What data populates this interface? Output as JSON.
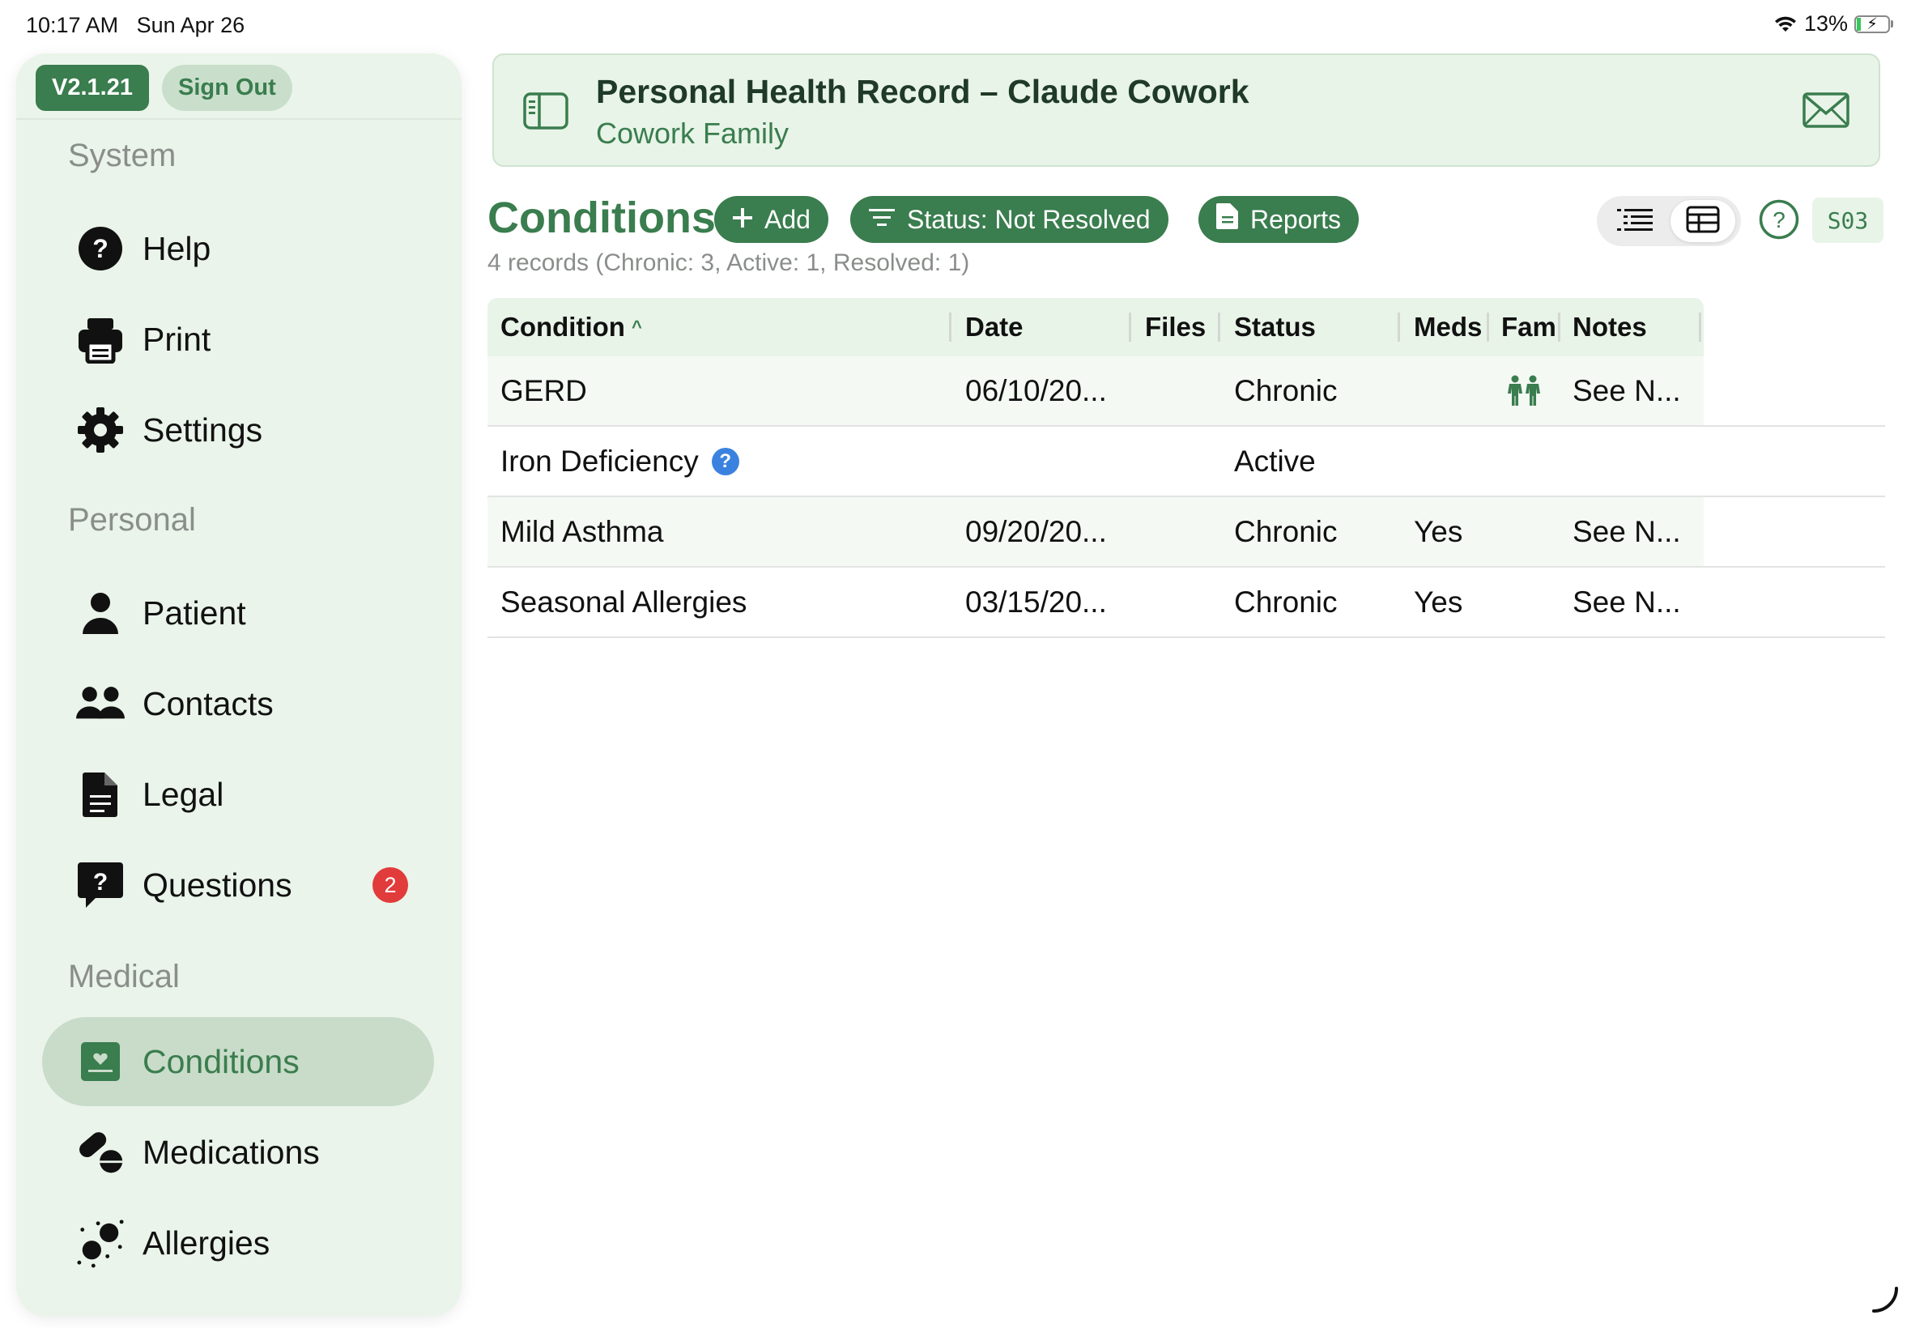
{
  "status_bar": {
    "time": "10:17 AM",
    "date": "Sun Apr 26",
    "battery": "13%",
    "battery_level": 0.13
  },
  "sidebar": {
    "version": "V2.1.21",
    "sign_out": "Sign Out",
    "sections": {
      "system": "System",
      "personal": "Personal",
      "medical": "Medical"
    },
    "items": {
      "help": "Help",
      "print": "Print",
      "settings": "Settings",
      "patient": "Patient",
      "contacts": "Contacts",
      "legal": "Legal",
      "questions": "Questions",
      "questions_badge": "2",
      "conditions": "Conditions",
      "medications": "Medications",
      "allergies": "Allergies"
    },
    "selected": "conditions"
  },
  "header": {
    "title": "Personal Health Record – Claude Cowork",
    "subtitle": "Cowork Family"
  },
  "toolbar": {
    "page_title": "Conditions",
    "add_label": "Add",
    "filter_label": "Status: Not Resolved",
    "reports_label": "Reports",
    "record_summary": "4 records  (Chronic: 3, Active: 1, Resolved: 1)",
    "screen_code": "S03",
    "active_view": "table"
  },
  "table": {
    "columns": {
      "condition": "Condition",
      "date": "Date",
      "files": "Files",
      "status": "Status",
      "meds": "Meds",
      "fam": "Fam",
      "notes": "Notes"
    },
    "sort_indicator": "^",
    "rows": [
      {
        "condition": "GERD",
        "date": "06/10/20...",
        "files": "",
        "status": "Chronic",
        "meds": "",
        "fam": "family-icon",
        "notes": "See N..."
      },
      {
        "condition": "Iron Deficiency",
        "info": "?",
        "date": "",
        "files": "",
        "status": "Active",
        "meds": "",
        "fam": "",
        "notes": ""
      },
      {
        "condition": "Mild Asthma",
        "date": "09/20/20...",
        "files": "",
        "status": "Chronic",
        "meds": "Yes",
        "fam": "",
        "notes": "See N..."
      },
      {
        "condition": "Seasonal Allergies",
        "date": "03/15/20...",
        "files": "",
        "status": "Chronic",
        "meds": "Yes",
        "fam": "",
        "notes": "See N..."
      }
    ]
  },
  "colors": {
    "accent": "#3a7d4e",
    "sidebar_bg": "#eaf4ea",
    "header_bg": "#e8f4e8",
    "badge": "#e23b3b",
    "info": "#3b82e0"
  }
}
